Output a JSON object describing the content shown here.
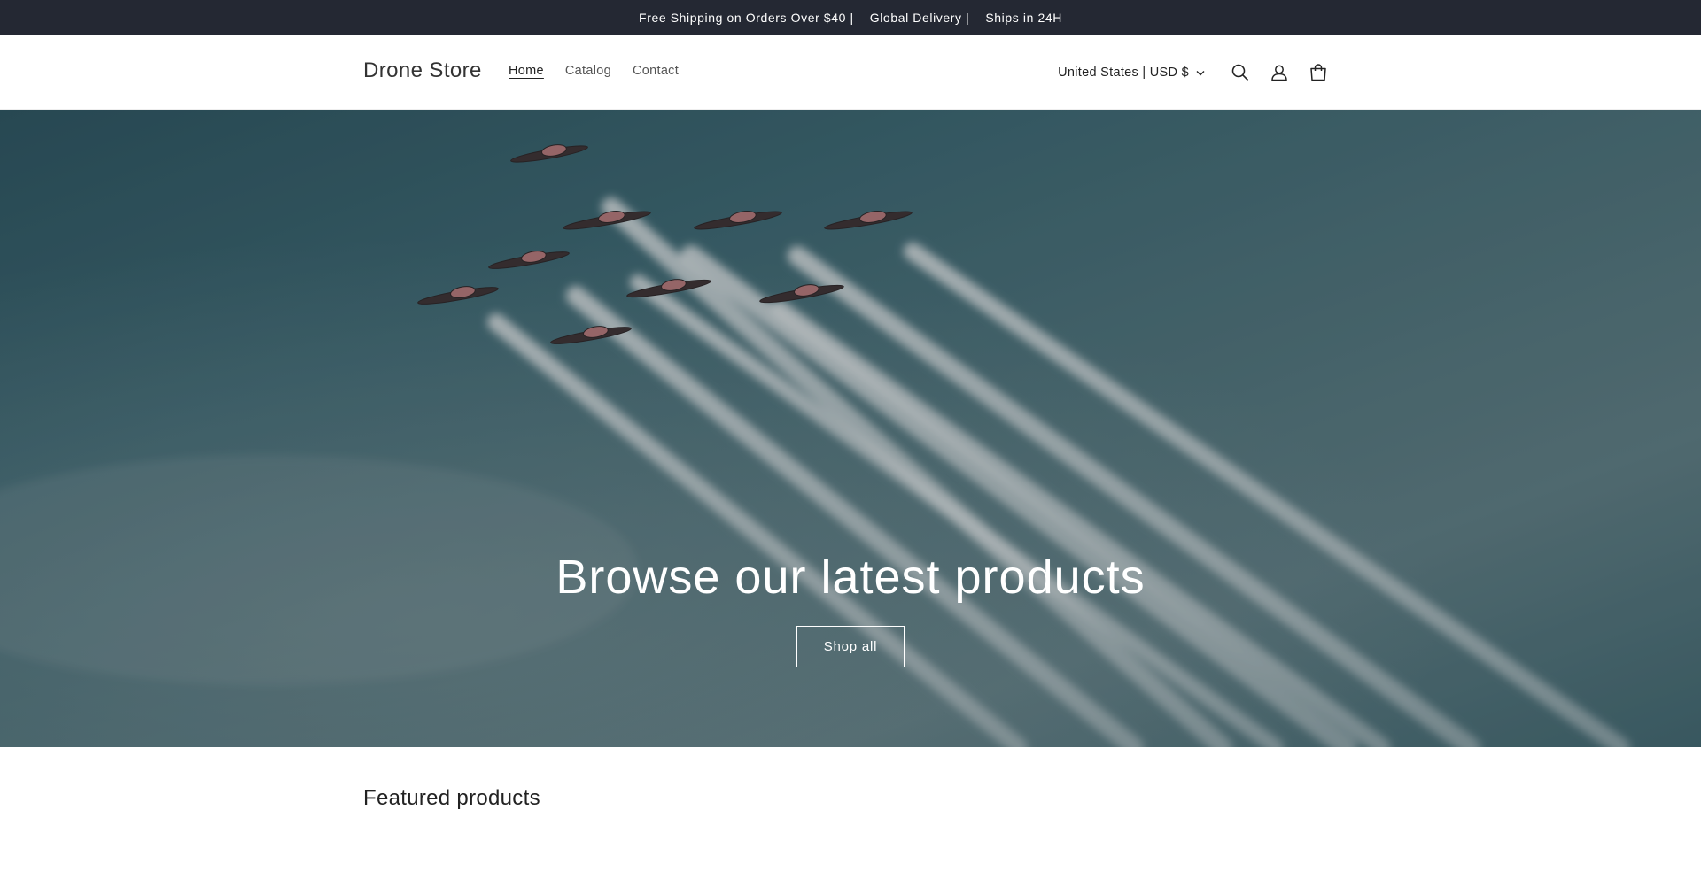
{
  "announcement": {
    "items": [
      "Free Shipping on Orders Over $40 |",
      "Global Delivery |",
      "Ships in 24H"
    ]
  },
  "header": {
    "logo": "Drone Store",
    "nav": [
      {
        "label": "Home",
        "active": true
      },
      {
        "label": "Catalog",
        "active": false
      },
      {
        "label": "Contact",
        "active": false
      }
    ],
    "locale": "United States | USD $",
    "icons": [
      "search-icon",
      "account-icon",
      "cart-icon"
    ]
  },
  "hero": {
    "title": "Browse our latest products",
    "button_label": "Shop all",
    "image_subject": "jet-formation-with-smoke-trails"
  },
  "featured": {
    "heading": "Featured products"
  },
  "colors": {
    "announcement_bg": "#242833",
    "hero_tint": "#3f5f66",
    "text": "#121212"
  }
}
